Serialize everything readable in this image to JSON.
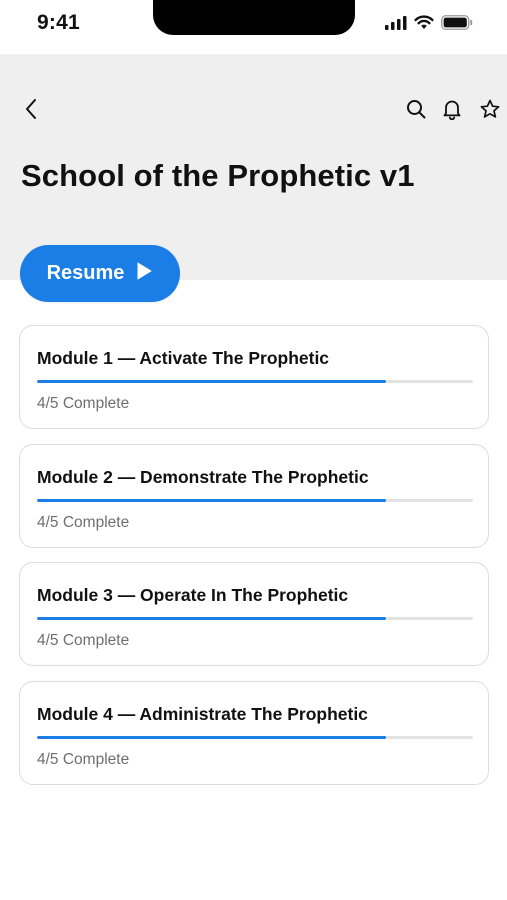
{
  "status_bar": {
    "time": "9:41",
    "icons": [
      "signal-icon",
      "wifi-icon",
      "battery-icon"
    ]
  },
  "header": {
    "back_icon": "chevron-left-icon",
    "action_icons": [
      "search-icon",
      "bell-icon",
      "star-icon"
    ],
    "title": "School of the Prophetic v1",
    "background": "#efefef"
  },
  "resume_button": {
    "label": "Resume",
    "icon": "play-icon",
    "color": "#1a7ee6"
  },
  "modules": [
    {
      "title": "Module 1 — Activate The Prophetic",
      "status": "4/5 Complete",
      "progress": 0.8
    },
    {
      "title": "Module 2 — Demonstrate The Prophetic",
      "status": "4/5 Complete",
      "progress": 0.8
    },
    {
      "title": "Module 3 — Operate In The Prophetic",
      "status": "4/5 Complete",
      "progress": 0.8
    },
    {
      "title": "Module 4 — Administrate The Prophetic",
      "status": "4/5 Complete",
      "progress": 0.8
    }
  ],
  "accent_color": "#1a7ee6"
}
